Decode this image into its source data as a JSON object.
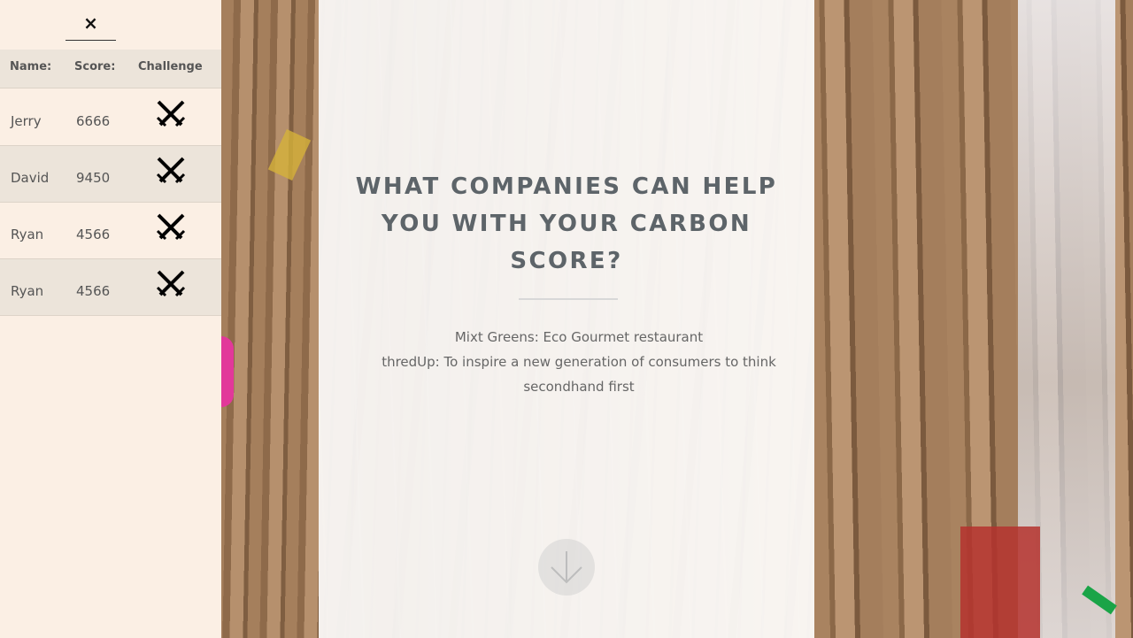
{
  "sidebar": {
    "close_symbol": "×",
    "headers": {
      "name": "Name:",
      "score": "Score:",
      "challenge": "Challenge"
    },
    "rows": [
      {
        "name": "Jerry",
        "score": "6666",
        "challenge_icon": "crossed-swords-icon"
      },
      {
        "name": "David",
        "score": "9450",
        "challenge_icon": "crossed-swords-icon"
      },
      {
        "name": "Ryan",
        "score": "4566",
        "challenge_icon": "crossed-swords-icon"
      },
      {
        "name": "Ryan",
        "score": "4566",
        "challenge_icon": "crossed-swords-icon"
      }
    ]
  },
  "main": {
    "title": "WHAT COMPANIES CAN HELP YOU WITH YOUR CARBON SCORE?",
    "companies": [
      "Mixt Greens: Eco Gourmet restaurant",
      "thredUp: To inspire a new generation of consumers to think secondhand first"
    ],
    "scroll_icon": "arrow-down-icon"
  },
  "colors": {
    "sidebar_bg": "#fbefe4",
    "sidebar_row_alt": "#ece4da",
    "title": "#5d6469",
    "body_text": "#666666"
  }
}
